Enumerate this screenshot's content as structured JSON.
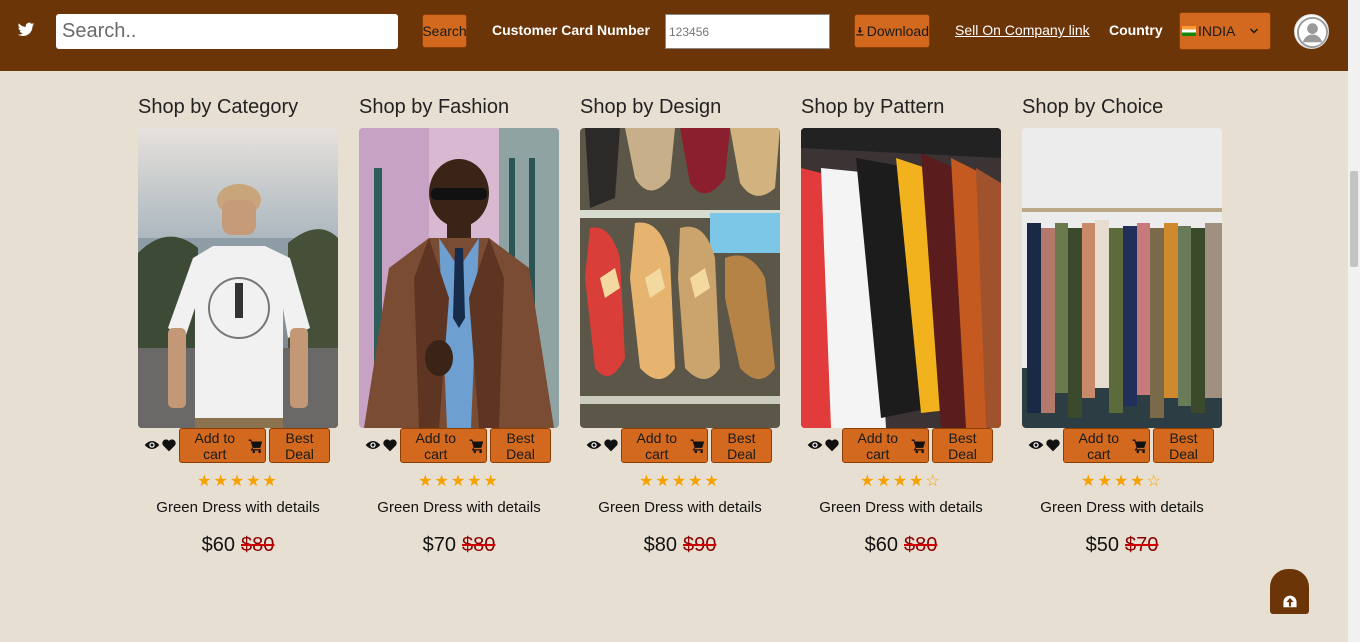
{
  "header": {
    "search_placeholder": "Search..",
    "search_button": "Search",
    "card_label": "Customer Card Number",
    "card_placeholder": "123456",
    "download_button": "Download",
    "sell_link": "Sell On Company link",
    "country_label": "Country",
    "country_value": "INDIA",
    "icons": [
      "twitter-icon",
      "download-icon",
      "chevron-down-icon",
      "avatar-icon"
    ]
  },
  "product_labels": {
    "add_to_cart": "Add to cart",
    "best_deal": "Best Deal"
  },
  "columns": [
    {
      "title": "Shop by Category",
      "name": "Green Dress with details",
      "price": "$60",
      "old_price": "$80",
      "rating": 5
    },
    {
      "title": "Shop by Fashion",
      "name": "Green Dress with details",
      "price": "$70",
      "old_price": "$80",
      "rating": 5
    },
    {
      "title": "Shop by Design",
      "name": "Green Dress with details",
      "price": "$80",
      "old_price": "$90",
      "rating": 5
    },
    {
      "title": "Shop by Pattern",
      "name": "Green Dress with details",
      "price": "$60",
      "old_price": "$80",
      "rating": 4
    },
    {
      "title": "Shop by Choice",
      "name": "Green Dress with details",
      "price": "$50",
      "old_price": "$70",
      "rating": 4
    }
  ],
  "colors": {
    "header_bg": "#6b3508",
    "button": "#d2691e",
    "page_bg": "#e8dfd3",
    "star": "#f5a100",
    "strike": "#d00000"
  }
}
